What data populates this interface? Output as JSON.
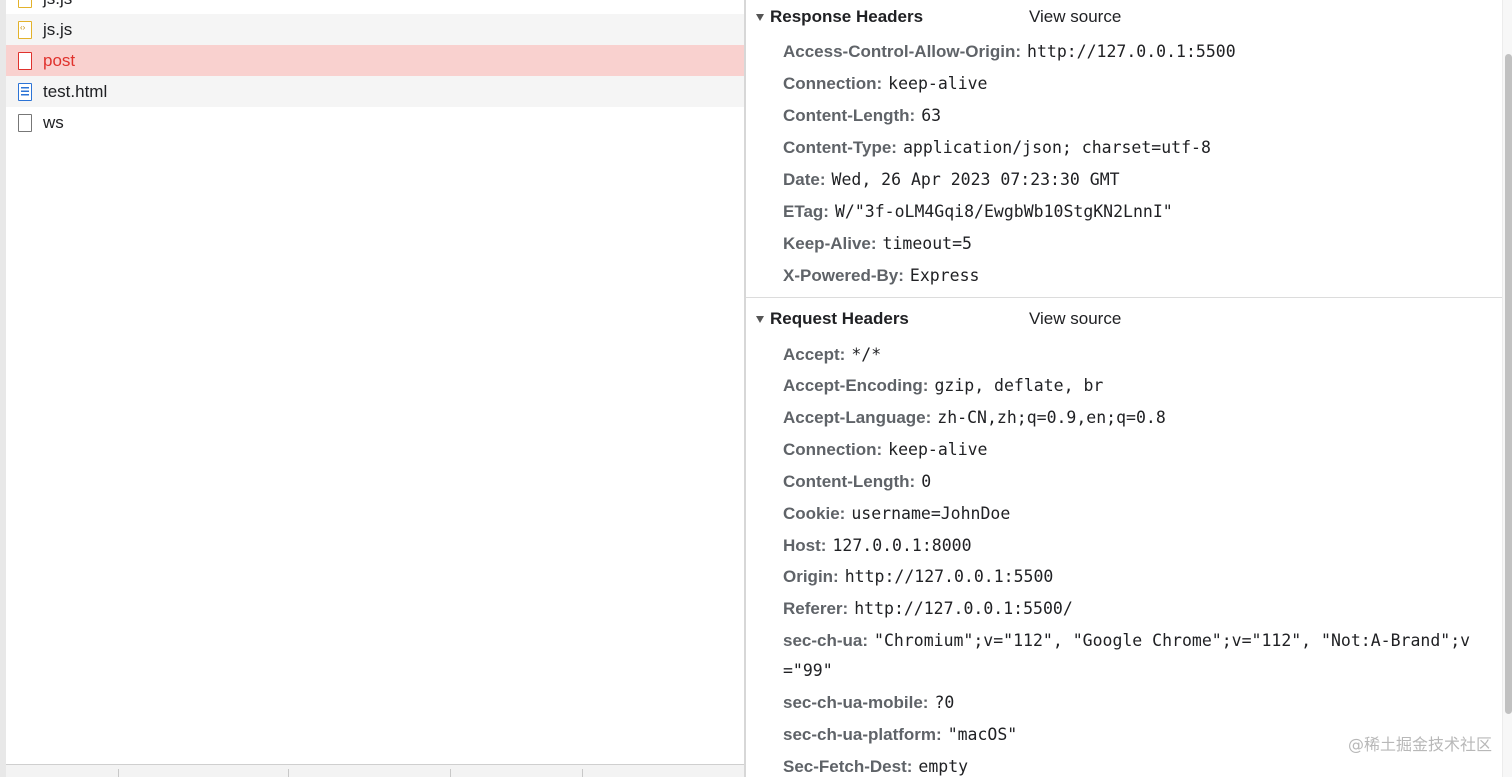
{
  "requests": [
    {
      "name": "js.js",
      "type": "js"
    },
    {
      "name": "js.js",
      "type": "js"
    },
    {
      "name": "post",
      "type": "err",
      "selected": true
    },
    {
      "name": "test.html",
      "type": "doc"
    },
    {
      "name": "ws",
      "type": "blank"
    }
  ],
  "response_headers": {
    "title": "Response Headers",
    "view_source": "View source",
    "items": [
      {
        "name": "Access-Control-Allow-Origin:",
        "value": "http://127.0.0.1:5500"
      },
      {
        "name": "Connection:",
        "value": "keep-alive"
      },
      {
        "name": "Content-Length:",
        "value": "63"
      },
      {
        "name": "Content-Type:",
        "value": "application/json; charset=utf-8"
      },
      {
        "name": "Date:",
        "value": "Wed, 26 Apr 2023 07:23:30 GMT"
      },
      {
        "name": "ETag:",
        "value": "W/\"3f-oLM4Gqi8/EwgbWb10StgKN2LnnI\""
      },
      {
        "name": "Keep-Alive:",
        "value": "timeout=5"
      },
      {
        "name": "X-Powered-By:",
        "value": "Express"
      }
    ]
  },
  "request_headers": {
    "title": "Request Headers",
    "view_source": "View source",
    "items": [
      {
        "name": "Accept:",
        "value": "*/*"
      },
      {
        "name": "Accept-Encoding:",
        "value": "gzip, deflate, br"
      },
      {
        "name": "Accept-Language:",
        "value": "zh-CN,zh;q=0.9,en;q=0.8"
      },
      {
        "name": "Connection:",
        "value": "keep-alive"
      },
      {
        "name": "Content-Length:",
        "value": "0"
      },
      {
        "name": "Cookie:",
        "value": "username=JohnDoe"
      },
      {
        "name": "Host:",
        "value": "127.0.0.1:8000"
      },
      {
        "name": "Origin:",
        "value": "http://127.0.0.1:5500"
      },
      {
        "name": "Referer:",
        "value": "http://127.0.0.1:5500/"
      },
      {
        "name": "sec-ch-ua:",
        "value": "\"Chromium\";v=\"112\", \"Google Chrome\";v=\"112\", \"Not:A-Brand\";v=\"99\""
      },
      {
        "name": "sec-ch-ua-mobile:",
        "value": "?0"
      },
      {
        "name": "sec-ch-ua-platform:",
        "value": "\"macOS\""
      },
      {
        "name": "Sec-Fetch-Dest:",
        "value": "empty"
      }
    ]
  },
  "watermark": "@稀土掘金技术社区",
  "colors": {
    "selected_bg": "#f9d1cf",
    "selected_text": "#e0322d",
    "header_name": "#5f6368"
  }
}
